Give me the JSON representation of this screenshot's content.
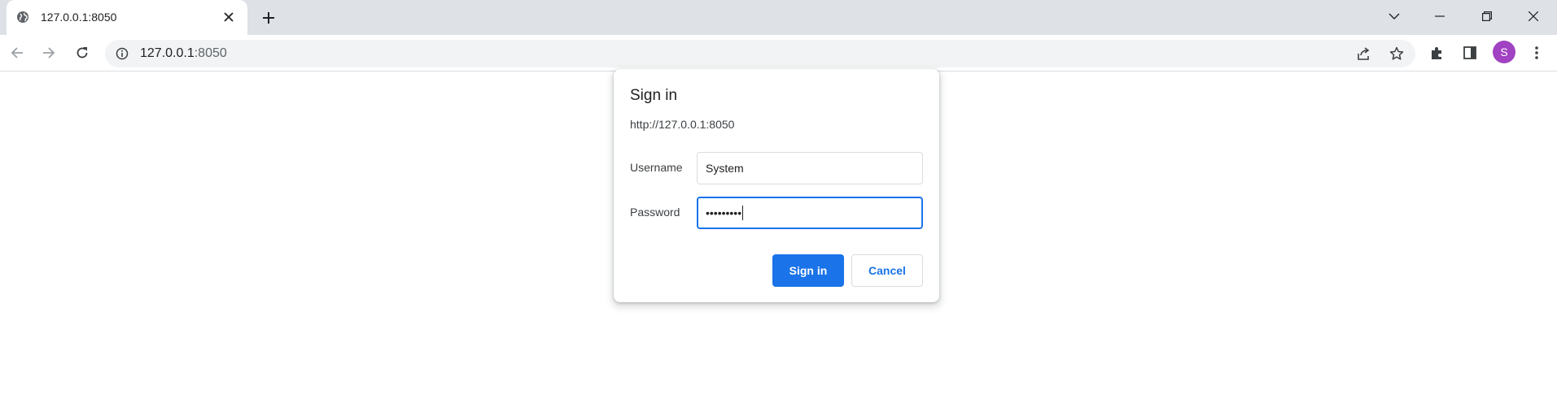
{
  "browser": {
    "tab": {
      "title": "127.0.0.1:8050"
    },
    "address": {
      "host": "127.0.0.1",
      "port": ":8050"
    },
    "profile_initial": "S"
  },
  "dialog": {
    "title": "Sign in",
    "origin": "http://127.0.0.1:8050",
    "username_label": "Username",
    "username_value": "System",
    "password_label": "Password",
    "password_masked": "•••••••••",
    "sign_in_label": "Sign in",
    "cancel_label": "Cancel"
  },
  "icons": {
    "tab_favicon": "globe-icon",
    "tab_close": "close-icon",
    "new_tab": "plus-icon",
    "back": "arrow-left-icon",
    "forward": "arrow-right-icon",
    "reload": "reload-icon",
    "site_info": "info-icon",
    "share": "share-icon",
    "bookmark": "star-icon",
    "extensions": "puzzle-icon",
    "side_panel": "side-panel-icon",
    "menu": "kebab-menu-icon"
  },
  "colors": {
    "accent": "#1a73e8",
    "avatar": "#a142c2",
    "tabstrip": "#dee1e6"
  }
}
